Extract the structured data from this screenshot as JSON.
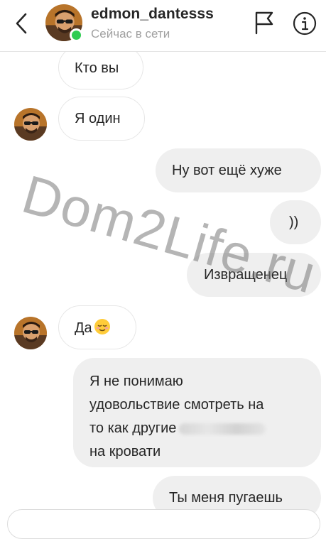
{
  "header": {
    "username": "edmon_dantesss",
    "status": "Сейчас в сети"
  },
  "messages": [
    {
      "from": "them",
      "text": "Кто вы"
    },
    {
      "from": "them",
      "text": "Я один"
    },
    {
      "from": "me",
      "text": "Ну вот ещё хуже"
    },
    {
      "from": "me",
      "text": "))"
    },
    {
      "from": "me",
      "text": "Извращенец"
    },
    {
      "from": "them",
      "text": "Да",
      "emoji": "relieved-face-emoji"
    },
    {
      "from": "me",
      "lines": [
        "Я не понимаю",
        "удовольствие смотреть на",
        "то как другие",
        "на кровати"
      ]
    },
    {
      "from": "me",
      "text": "Ты меня пугаешь"
    }
  ],
  "watermark": "Dom2Life.ru",
  "colors": {
    "online": "#2fcc52",
    "bubble_out": "#efefef",
    "bubble_in_border": "#e6e6e6",
    "status_text": "#a0a0a0"
  },
  "icons": [
    "back-chevron-icon",
    "flag-icon",
    "info-icon"
  ]
}
